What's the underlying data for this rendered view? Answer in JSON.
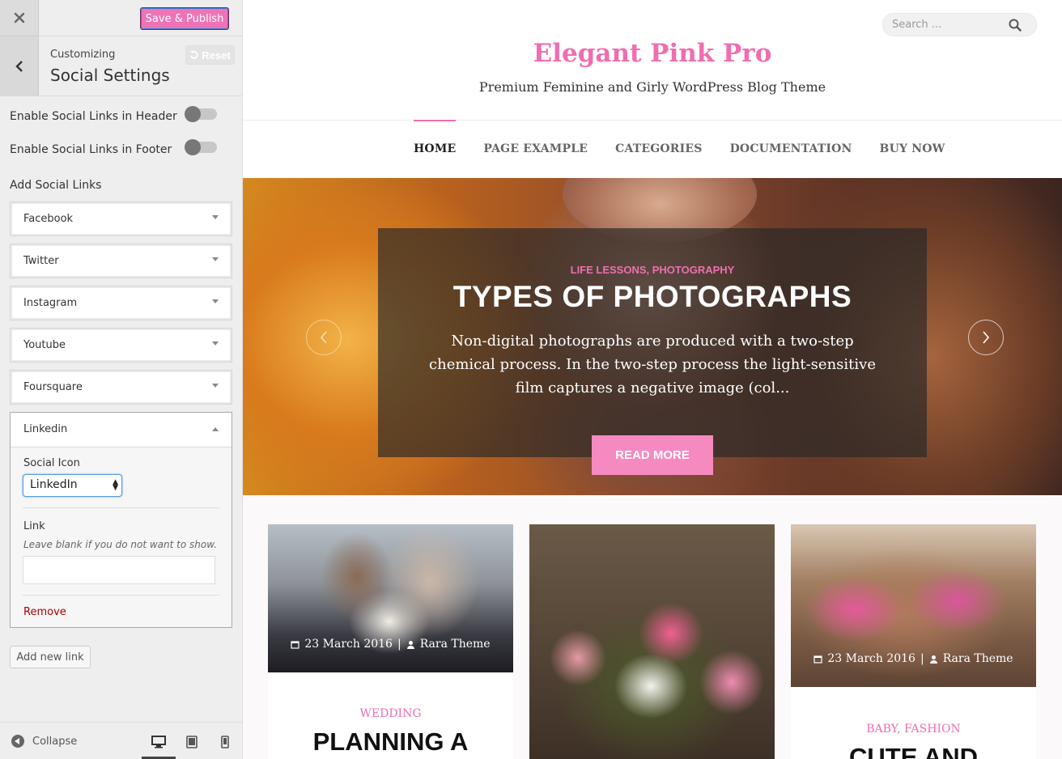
{
  "sidebar": {
    "publish_label": "Save & Publish",
    "customizing_label": "Customizing",
    "section_title": "Social Settings",
    "reset_label": "Reset",
    "toggle_header_label": "Enable Social Links in Header",
    "toggle_header_on": false,
    "toggle_footer_label": "Enable Social Links in Footer",
    "toggle_footer_on": false,
    "add_social_label": "Add Social Links",
    "social_items": [
      "Facebook",
      "Twitter",
      "Instagram",
      "Youtube",
      "Foursquare"
    ],
    "open_item": {
      "title": "Linkedin",
      "icon_label": "Social Icon",
      "icon_value": "LinkedIn",
      "link_label": "Link",
      "link_description": "Leave blank if you do not want to show.",
      "link_value": "",
      "remove_label": "Remove"
    },
    "add_new_label": "Add new link",
    "collapse_label": "Collapse",
    "accent": "#ee74b8"
  },
  "site": {
    "search_placeholder": "Search ...",
    "title": "Elegant Pink Pro",
    "tagline": "Premium Feminine and Girly WordPress Blog Theme",
    "nav": [
      "HOME",
      "PAGE EXAMPLE",
      "CATEGORIES",
      "DOCUMENTATION",
      "BUY NOW"
    ],
    "active_nav": "HOME",
    "brand_color": "#f06eb0",
    "slider": {
      "category": "LIFE LESSONS, PHOTOGRAPHY",
      "title": "TYPES OF PHOTOGRAPHS",
      "excerpt": "Non-digital photographs are produced with a two-step chemical process. In the two-step process the light-sensitive film captures a negative image (col...",
      "button": "READ MORE"
    },
    "posts": [
      {
        "date": "23 March 2016",
        "author": "Rara Theme",
        "category": "WEDDING",
        "title": "PLANNING A"
      },
      {
        "date": "",
        "author": "",
        "category": "",
        "title": ""
      },
      {
        "date": "23 March 2016",
        "author": "Rara Theme",
        "category": "BABY, FASHION",
        "title": "CUTE AND"
      }
    ]
  }
}
